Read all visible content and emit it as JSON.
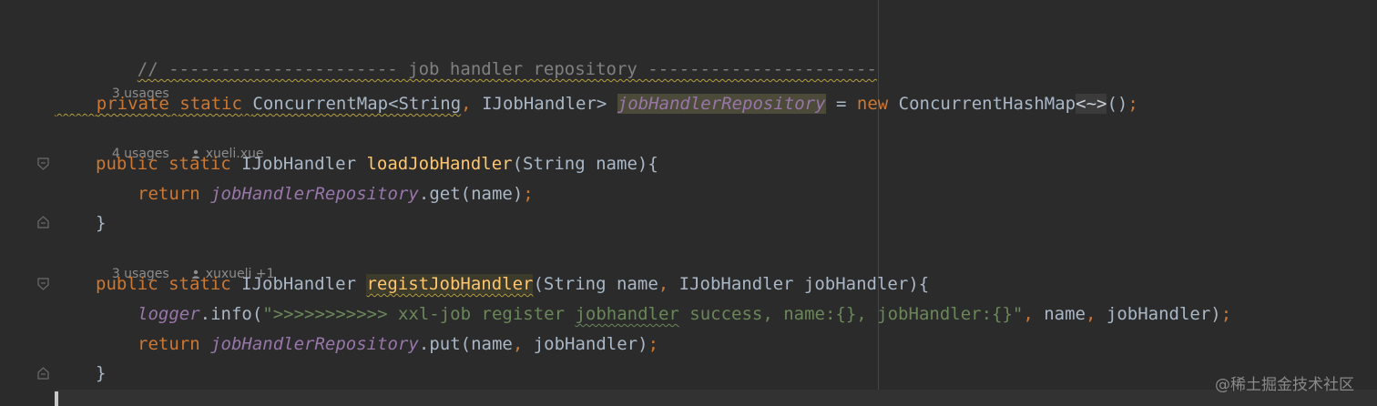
{
  "editor": {
    "comment_line": "// ---------------------- job handler repository ----------------------",
    "hint1": {
      "usages": "3 usages"
    },
    "line_field": {
      "private": "private",
      "static": "static",
      "type": "ConcurrentMap<String",
      "comma": ",",
      "type2": " IJobHandler> ",
      "field": "jobHandlerRepository",
      "eq": " = ",
      "new": "new",
      "ctor": " ConcurrentHashMap",
      "diamond": "<~>",
      "tail": "()",
      "semi": ";"
    },
    "hint2": {
      "usages": "4 usages",
      "author": "xueli.xue"
    },
    "line_load": {
      "public": "public",
      "static": "static",
      "ret": " IJobHandler ",
      "name": "loadJobHandler",
      "params": "(String name){"
    },
    "line_load_body": {
      "return": "return",
      "field": "jobHandlerRepository",
      "call": ".get(name)",
      "semi": ";"
    },
    "close1": "}",
    "hint3": {
      "usages": "3 usages",
      "author": "xuxueli +1"
    },
    "line_regist": {
      "public": "public",
      "static": "static",
      "ret": " IJobHandler ",
      "name": "registJobHandler",
      "p1": "(String name",
      "comma": ",",
      "p2": " IJobHandler jobHandler){"
    },
    "line_logger": {
      "logger": "logger",
      "info": ".info(",
      "str1": "\">>>>>>>>>>> xxl-job register ",
      "str_wavy": "jobhandler",
      "str2": " success, name:{}, jobHandler:{}\"",
      "c1": ",",
      "a1": " name",
      "c2": ",",
      "a2": " jobHandler)",
      "semi": ";"
    },
    "line_put": {
      "return": "return",
      "field": "jobHandlerRepository",
      "call": ".put(name",
      "comma": ",",
      "arg": " jobHandler)",
      "semi": ";"
    },
    "close2": "}"
  },
  "watermark": "@稀土掘金技术社区",
  "colors": {
    "background": "#2b2b2b",
    "keyword": "#cc7832",
    "function": "#ffc66d",
    "string": "#6a8759",
    "field": "#9876aa",
    "comment": "#808080",
    "text": "#a9b7c6"
  }
}
